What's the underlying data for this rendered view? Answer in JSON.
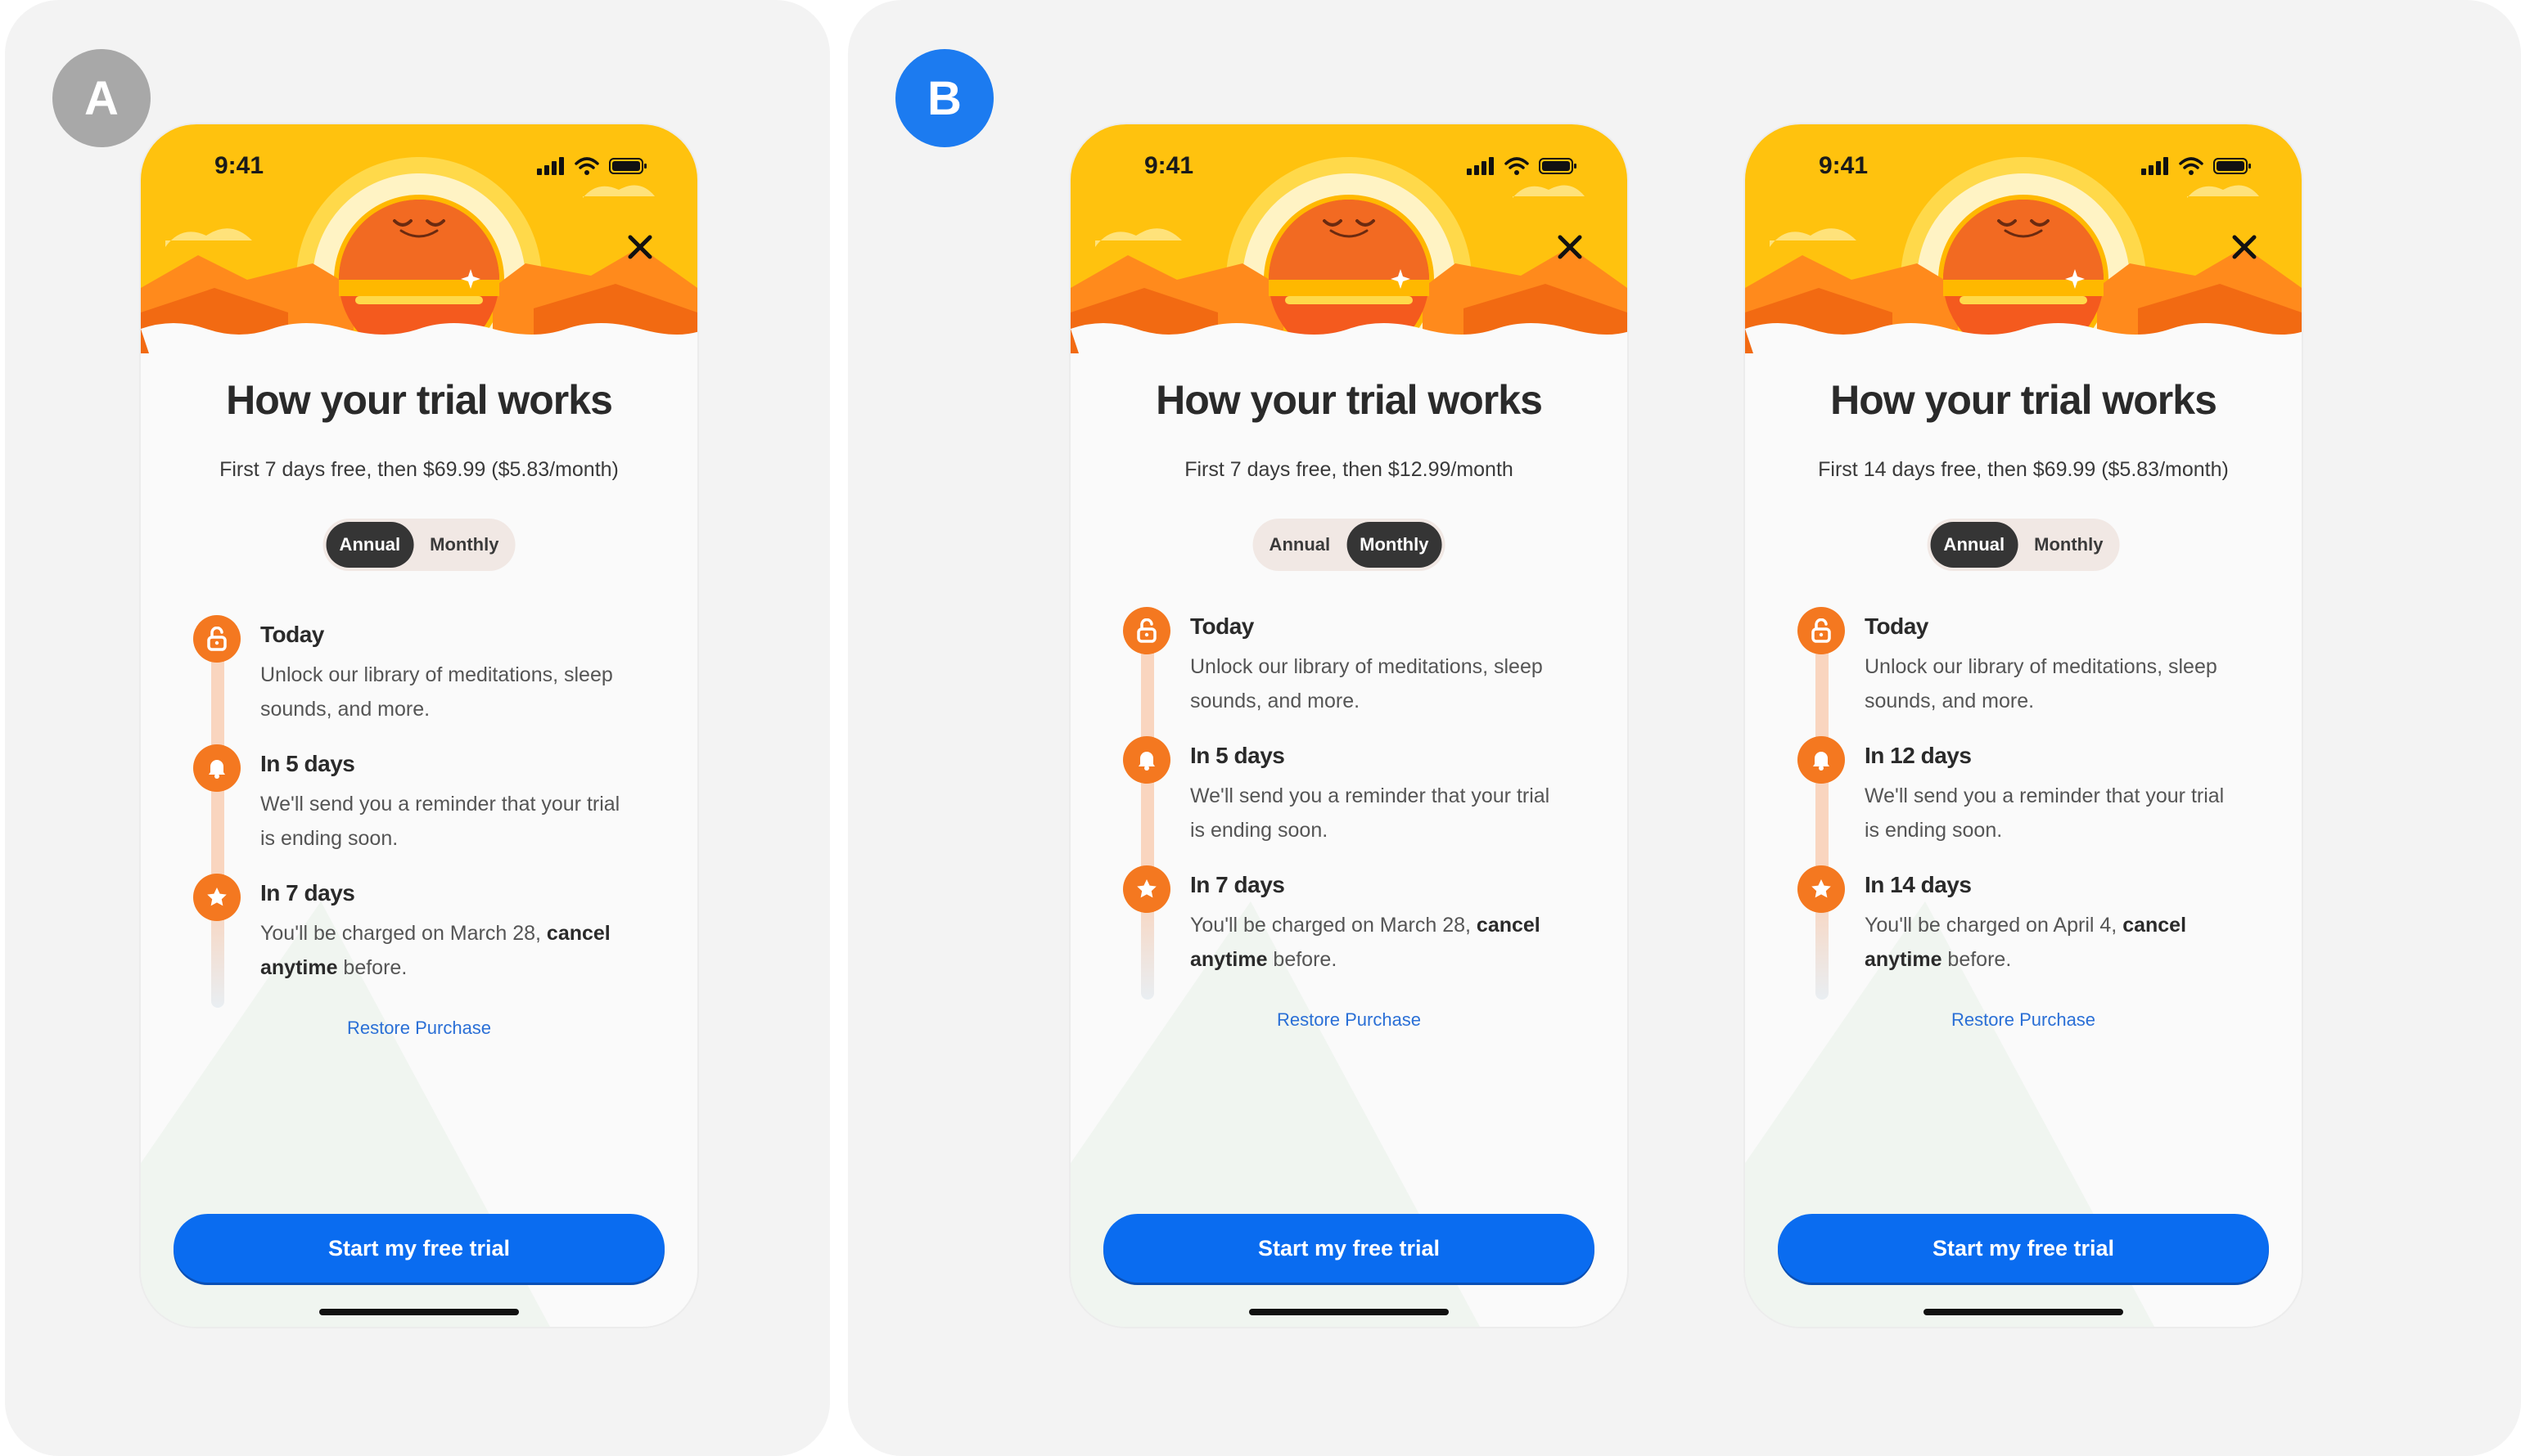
{
  "variants": [
    {
      "label": "A",
      "color": "#a8a8a8"
    },
    {
      "label": "B",
      "color": "#1c7bf0"
    }
  ],
  "screens": [
    {
      "time": "9:41",
      "title": "How your trial works",
      "subtitle": "First 7 days free, then $69.99 ($5.83/month)",
      "toggle": {
        "annual": "Annual",
        "monthly": "Monthly",
        "selected": "annual"
      },
      "steps": [
        {
          "icon": "lock-open-icon",
          "title": "Today",
          "desc_pre": "Unlock our library of meditations, sleep sounds, and more.",
          "desc_bold": "",
          "desc_post": ""
        },
        {
          "icon": "bell-icon",
          "title": "In 5 days",
          "desc_pre": "We'll send you a reminder that your trial is ending soon.",
          "desc_bold": "",
          "desc_post": ""
        },
        {
          "icon": "star-icon",
          "title": "In 7 days",
          "desc_pre": "You'll be charged on March 28,",
          "desc_bold": "cancel anytime",
          "desc_post": " before."
        }
      ],
      "restore": "Restore Purchase",
      "cta": "Start my free trial"
    },
    {
      "time": "9:41",
      "title": "How your trial works",
      "subtitle": "First 7 days free, then $12.99/month",
      "toggle": {
        "annual": "Annual",
        "monthly": "Monthly",
        "selected": "monthly"
      },
      "steps": [
        {
          "icon": "lock-open-icon",
          "title": "Today",
          "desc_pre": "Unlock our library of meditations, sleep sounds, and more.",
          "desc_bold": "",
          "desc_post": ""
        },
        {
          "icon": "bell-icon",
          "title": "In 5 days",
          "desc_pre": "We'll send you a reminder that your trial is ending soon.",
          "desc_bold": "",
          "desc_post": ""
        },
        {
          "icon": "star-icon",
          "title": "In 7 days",
          "desc_pre": "You'll be charged on March 28,",
          "desc_bold": "cancel anytime",
          "desc_post": " before."
        }
      ],
      "restore": "Restore Purchase",
      "cta": "Start my free trial"
    },
    {
      "time": "9:41",
      "title": "How your trial works",
      "subtitle": "First 14 days free, then $69.99 ($5.83/month)",
      "toggle": {
        "annual": "Annual",
        "monthly": "Monthly",
        "selected": "annual"
      },
      "steps": [
        {
          "icon": "lock-open-icon",
          "title": "Today",
          "desc_pre": "Unlock our library of meditations, sleep sounds, and more.",
          "desc_bold": "",
          "desc_post": ""
        },
        {
          "icon": "bell-icon",
          "title": "In 12 days",
          "desc_pre": "We'll send you a reminder that your trial is ending soon.",
          "desc_bold": "",
          "desc_post": ""
        },
        {
          "icon": "star-icon",
          "title": "In 14 days",
          "desc_pre": "You'll be charged on April 4,",
          "desc_bold": "cancel anytime",
          "desc_post": " before."
        }
      ],
      "restore": "Restore Purchase",
      "cta": "Start my free trial"
    }
  ],
  "colors": {
    "accent": "#f47820",
    "cta": "#0a6cf0",
    "link": "#2a6fd6"
  }
}
